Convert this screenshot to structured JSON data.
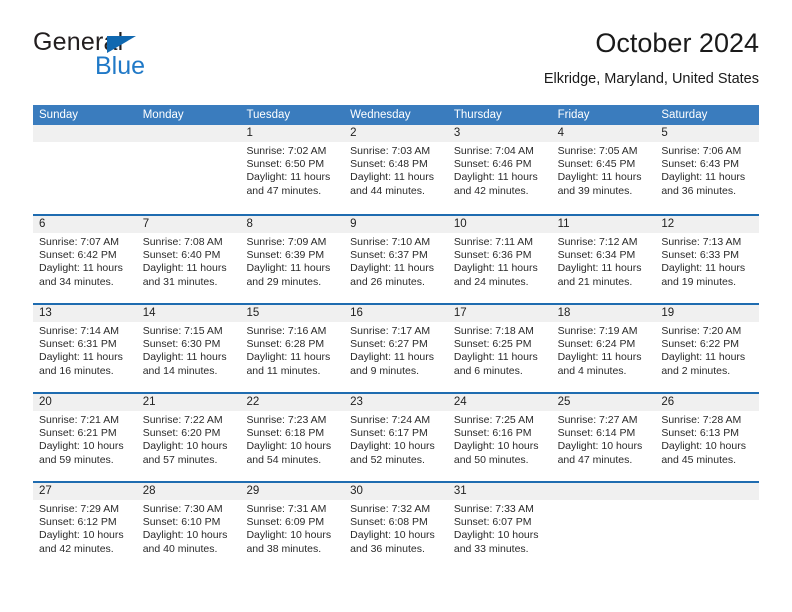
{
  "brand": {
    "name_part1": "General",
    "name_part2": "Blue",
    "colors": {
      "general": "#231f20",
      "blue": "#2079c7",
      "triangle": "#1068b0"
    }
  },
  "header": {
    "title": "October 2024",
    "subtitle": "Elkridge, Maryland, United States"
  },
  "calendar": {
    "colors": {
      "weekday_header_bg": "#3a7cbe",
      "week_separator": "#1f6cb0",
      "day_number_bg": "#f0f0f0"
    },
    "weekdays": [
      "Sunday",
      "Monday",
      "Tuesday",
      "Wednesday",
      "Thursday",
      "Friday",
      "Saturday"
    ],
    "weeks": [
      [
        {
          "day": "",
          "empty": true
        },
        {
          "day": "",
          "empty": true
        },
        {
          "day": "1",
          "sunrise": "Sunrise: 7:02 AM",
          "sunset": "Sunset: 6:50 PM",
          "daylight_line1": "Daylight: 11 hours",
          "daylight_line2": "and 47 minutes."
        },
        {
          "day": "2",
          "sunrise": "Sunrise: 7:03 AM",
          "sunset": "Sunset: 6:48 PM",
          "daylight_line1": "Daylight: 11 hours",
          "daylight_line2": "and 44 minutes."
        },
        {
          "day": "3",
          "sunrise": "Sunrise: 7:04 AM",
          "sunset": "Sunset: 6:46 PM",
          "daylight_line1": "Daylight: 11 hours",
          "daylight_line2": "and 42 minutes."
        },
        {
          "day": "4",
          "sunrise": "Sunrise: 7:05 AM",
          "sunset": "Sunset: 6:45 PM",
          "daylight_line1": "Daylight: 11 hours",
          "daylight_line2": "and 39 minutes."
        },
        {
          "day": "5",
          "sunrise": "Sunrise: 7:06 AM",
          "sunset": "Sunset: 6:43 PM",
          "daylight_line1": "Daylight: 11 hours",
          "daylight_line2": "and 36 minutes."
        }
      ],
      [
        {
          "day": "6",
          "sunrise": "Sunrise: 7:07 AM",
          "sunset": "Sunset: 6:42 PM",
          "daylight_line1": "Daylight: 11 hours",
          "daylight_line2": "and 34 minutes."
        },
        {
          "day": "7",
          "sunrise": "Sunrise: 7:08 AM",
          "sunset": "Sunset: 6:40 PM",
          "daylight_line1": "Daylight: 11 hours",
          "daylight_line2": "and 31 minutes."
        },
        {
          "day": "8",
          "sunrise": "Sunrise: 7:09 AM",
          "sunset": "Sunset: 6:39 PM",
          "daylight_line1": "Daylight: 11 hours",
          "daylight_line2": "and 29 minutes."
        },
        {
          "day": "9",
          "sunrise": "Sunrise: 7:10 AM",
          "sunset": "Sunset: 6:37 PM",
          "daylight_line1": "Daylight: 11 hours",
          "daylight_line2": "and 26 minutes."
        },
        {
          "day": "10",
          "sunrise": "Sunrise: 7:11 AM",
          "sunset": "Sunset: 6:36 PM",
          "daylight_line1": "Daylight: 11 hours",
          "daylight_line2": "and 24 minutes."
        },
        {
          "day": "11",
          "sunrise": "Sunrise: 7:12 AM",
          "sunset": "Sunset: 6:34 PM",
          "daylight_line1": "Daylight: 11 hours",
          "daylight_line2": "and 21 minutes."
        },
        {
          "day": "12",
          "sunrise": "Sunrise: 7:13 AM",
          "sunset": "Sunset: 6:33 PM",
          "daylight_line1": "Daylight: 11 hours",
          "daylight_line2": "and 19 minutes."
        }
      ],
      [
        {
          "day": "13",
          "sunrise": "Sunrise: 7:14 AM",
          "sunset": "Sunset: 6:31 PM",
          "daylight_line1": "Daylight: 11 hours",
          "daylight_line2": "and 16 minutes."
        },
        {
          "day": "14",
          "sunrise": "Sunrise: 7:15 AM",
          "sunset": "Sunset: 6:30 PM",
          "daylight_line1": "Daylight: 11 hours",
          "daylight_line2": "and 14 minutes."
        },
        {
          "day": "15",
          "sunrise": "Sunrise: 7:16 AM",
          "sunset": "Sunset: 6:28 PM",
          "daylight_line1": "Daylight: 11 hours",
          "daylight_line2": "and 11 minutes."
        },
        {
          "day": "16",
          "sunrise": "Sunrise: 7:17 AM",
          "sunset": "Sunset: 6:27 PM",
          "daylight_line1": "Daylight: 11 hours",
          "daylight_line2": "and 9 minutes."
        },
        {
          "day": "17",
          "sunrise": "Sunrise: 7:18 AM",
          "sunset": "Sunset: 6:25 PM",
          "daylight_line1": "Daylight: 11 hours",
          "daylight_line2": "and 6 minutes."
        },
        {
          "day": "18",
          "sunrise": "Sunrise: 7:19 AM",
          "sunset": "Sunset: 6:24 PM",
          "daylight_line1": "Daylight: 11 hours",
          "daylight_line2": "and 4 minutes."
        },
        {
          "day": "19",
          "sunrise": "Sunrise: 7:20 AM",
          "sunset": "Sunset: 6:22 PM",
          "daylight_line1": "Daylight: 11 hours",
          "daylight_line2": "and 2 minutes."
        }
      ],
      [
        {
          "day": "20",
          "sunrise": "Sunrise: 7:21 AM",
          "sunset": "Sunset: 6:21 PM",
          "daylight_line1": "Daylight: 10 hours",
          "daylight_line2": "and 59 minutes."
        },
        {
          "day": "21",
          "sunrise": "Sunrise: 7:22 AM",
          "sunset": "Sunset: 6:20 PM",
          "daylight_line1": "Daylight: 10 hours",
          "daylight_line2": "and 57 minutes."
        },
        {
          "day": "22",
          "sunrise": "Sunrise: 7:23 AM",
          "sunset": "Sunset: 6:18 PM",
          "daylight_line1": "Daylight: 10 hours",
          "daylight_line2": "and 54 minutes."
        },
        {
          "day": "23",
          "sunrise": "Sunrise: 7:24 AM",
          "sunset": "Sunset: 6:17 PM",
          "daylight_line1": "Daylight: 10 hours",
          "daylight_line2": "and 52 minutes."
        },
        {
          "day": "24",
          "sunrise": "Sunrise: 7:25 AM",
          "sunset": "Sunset: 6:16 PM",
          "daylight_line1": "Daylight: 10 hours",
          "daylight_line2": "and 50 minutes."
        },
        {
          "day": "25",
          "sunrise": "Sunrise: 7:27 AM",
          "sunset": "Sunset: 6:14 PM",
          "daylight_line1": "Daylight: 10 hours",
          "daylight_line2": "and 47 minutes."
        },
        {
          "day": "26",
          "sunrise": "Sunrise: 7:28 AM",
          "sunset": "Sunset: 6:13 PM",
          "daylight_line1": "Daylight: 10 hours",
          "daylight_line2": "and 45 minutes."
        }
      ],
      [
        {
          "day": "27",
          "sunrise": "Sunrise: 7:29 AM",
          "sunset": "Sunset: 6:12 PM",
          "daylight_line1": "Daylight: 10 hours",
          "daylight_line2": "and 42 minutes."
        },
        {
          "day": "28",
          "sunrise": "Sunrise: 7:30 AM",
          "sunset": "Sunset: 6:10 PM",
          "daylight_line1": "Daylight: 10 hours",
          "daylight_line2": "and 40 minutes."
        },
        {
          "day": "29",
          "sunrise": "Sunrise: 7:31 AM",
          "sunset": "Sunset: 6:09 PM",
          "daylight_line1": "Daylight: 10 hours",
          "daylight_line2": "and 38 minutes."
        },
        {
          "day": "30",
          "sunrise": "Sunrise: 7:32 AM",
          "sunset": "Sunset: 6:08 PM",
          "daylight_line1": "Daylight: 10 hours",
          "daylight_line2": "and 36 minutes."
        },
        {
          "day": "31",
          "sunrise": "Sunrise: 7:33 AM",
          "sunset": "Sunset: 6:07 PM",
          "daylight_line1": "Daylight: 10 hours",
          "daylight_line2": "and 33 minutes."
        },
        {
          "day": "",
          "empty": true
        },
        {
          "day": "",
          "empty": true
        }
      ]
    ]
  }
}
